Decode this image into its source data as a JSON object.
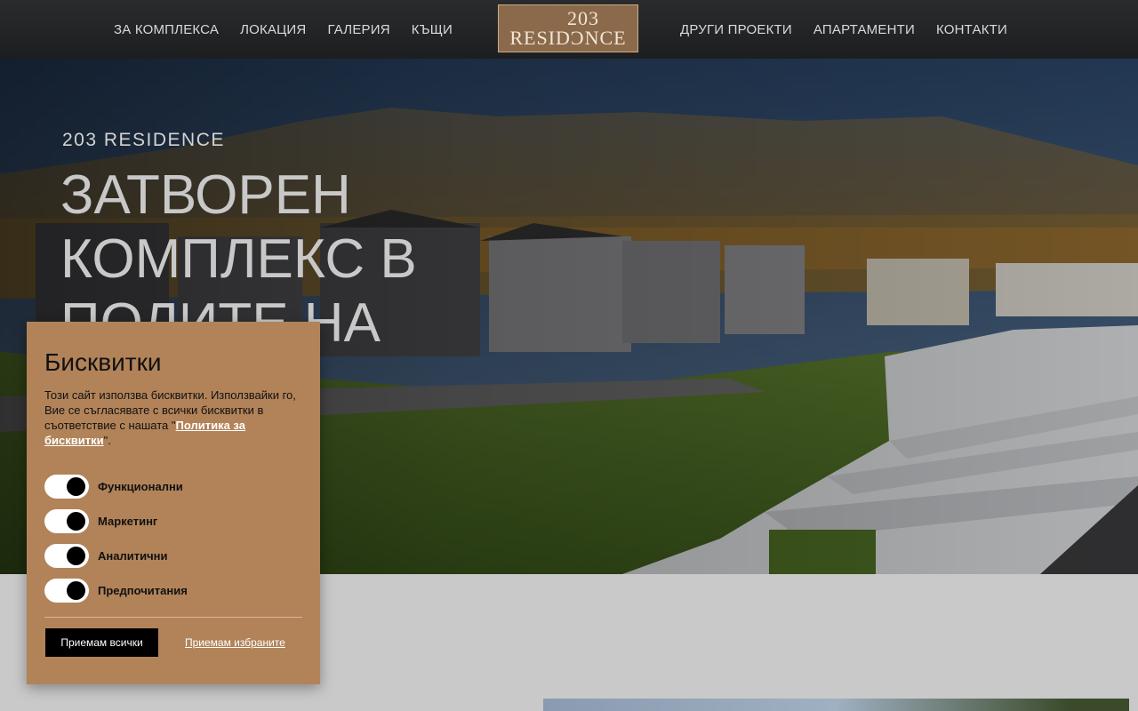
{
  "nav": {
    "left": [
      "ЗА КОМПЛЕКСА",
      "ЛОКАЦИЯ",
      "ГАЛЕРИЯ",
      "КЪЩИ"
    ],
    "right": [
      "ДРУГИ ПРОЕКТИ",
      "АПАРТАМЕНТИ",
      "КОНТАКТИ"
    ],
    "logo_number": "203",
    "logo_word": "RESIDƆNCE"
  },
  "hero": {
    "kicker": "203 RESIDENCE",
    "title": "ЗАТВОРЕН КОМПЛЕКС В ПОЛИТЕ НА"
  },
  "cookie": {
    "title": "Бисквитки",
    "text_before": "Този сайт използва бисквитки. Използвайки го, Вие се съгласявате с всички бисквитки в съответствие с нашата \"",
    "policy_link": "Политика за бисквитки",
    "text_after": "\".",
    "toggles": [
      {
        "label": "Функционални",
        "on": true
      },
      {
        "label": "Маркетинг",
        "on": true
      },
      {
        "label": "Аналитични",
        "on": true
      },
      {
        "label": "Предпочитания",
        "on": true
      }
    ],
    "accept_all": "Приемам всички",
    "accept_selected": "Приемам избраните"
  },
  "colors": {
    "panel": "#b28359",
    "nav_bg": "#1d1e20",
    "logo_bg": "#8b6a4b"
  }
}
